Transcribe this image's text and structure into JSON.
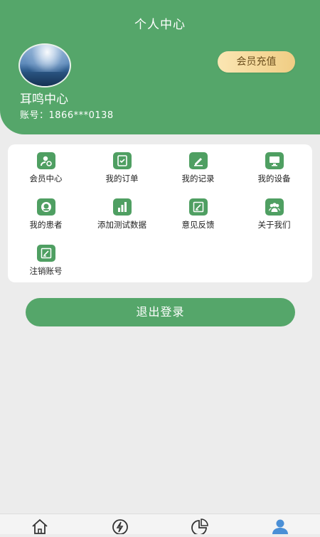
{
  "header": {
    "title": "个人中心",
    "username": "耳鸣中心",
    "account": "账号：1866***0138",
    "recharge_label": "会员充值"
  },
  "menu": [
    {
      "label": "会员中心",
      "icon": "member-icon"
    },
    {
      "label": "我的订单",
      "icon": "order-icon"
    },
    {
      "label": "我的记录",
      "icon": "record-icon"
    },
    {
      "label": "我的设备",
      "icon": "device-icon"
    },
    {
      "label": "我的患者",
      "icon": "patient-icon"
    },
    {
      "label": "添加测试数据",
      "icon": "chart-icon"
    },
    {
      "label": "意见反馈",
      "icon": "feedback-icon"
    },
    {
      "label": "关于我们",
      "icon": "about-icon"
    },
    {
      "label": "注销账号",
      "icon": "cancel-account-icon"
    }
  ],
  "logout_label": "退出登录",
  "tabbar": {
    "items": [
      {
        "icon": "home-icon"
      },
      {
        "icon": "lightning-icon"
      },
      {
        "icon": "pie-chart-icon"
      },
      {
        "icon": "user-icon",
        "active": true
      }
    ],
    "active_color": "#4a8fd6"
  },
  "colors": {
    "brand_green": "#55a66a",
    "recharge_gold": "#f0cd84"
  }
}
